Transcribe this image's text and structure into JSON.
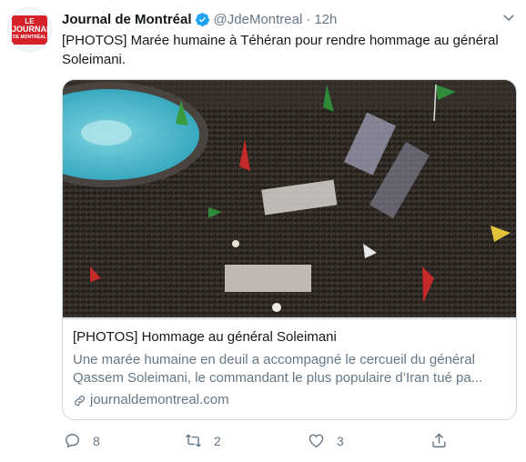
{
  "tweet": {
    "author_name": "Journal de Montréal",
    "handle": "@JdeMontreal",
    "separator": "·",
    "time": "12h",
    "text": "[PHOTOS] Marée humaine à Téhéran pour rendre hommage au général Soleimani."
  },
  "avatar": {
    "logo_line1": "LE",
    "logo_line2": "JOURNAL",
    "logo_line3": "DE MONTRÉAL"
  },
  "card": {
    "title": "[PHOTOS] Hommage au général Soleimani",
    "description": "Une marée humaine en deuil a accompagné le cercueil du général Qassem Soleimani, le commandant le plus populaire d’Iran tué pa...",
    "domain": "journaldemontreal.com"
  },
  "actions": {
    "replies": "8",
    "retweets": "2",
    "likes": "3"
  },
  "colors": {
    "accent": "#1da1f2",
    "secondary_text": "#657786",
    "border": "#ccd6dd",
    "logo_red": "#d6212a"
  }
}
